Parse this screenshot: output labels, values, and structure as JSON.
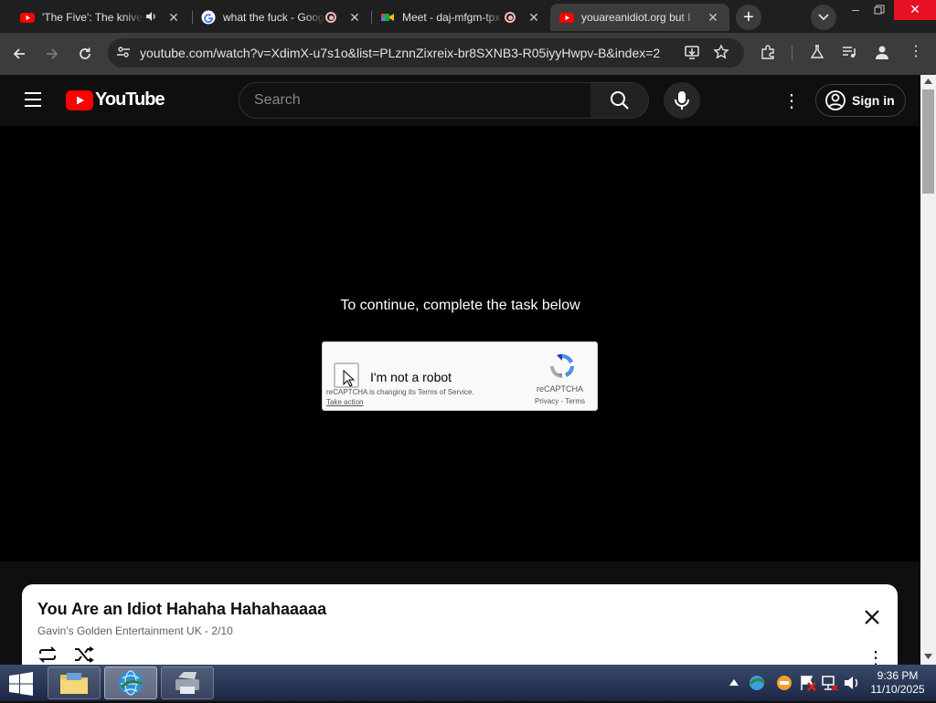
{
  "browser": {
    "tabs": [
      {
        "title": "'The Five': The knives",
        "favicon": "youtube"
      },
      {
        "title": "what the fuck - Google",
        "favicon": "google"
      },
      {
        "title": "Meet - daj-mfgm-tpx",
        "favicon": "meet"
      },
      {
        "title": "youareanidiot.org but I",
        "favicon": "youtube"
      }
    ],
    "url": "youtube.com/watch?v=XdimX-u7s1o&list=PLznnZixreix-br8SXNB3-R05iyyHwpv-B&index=2"
  },
  "yt": {
    "logo_text": "YouTube",
    "search_placeholder": "Search",
    "signin_label": "Sign in"
  },
  "player": {
    "message": "To continue, complete the task below"
  },
  "captcha": {
    "label": "I'm not a robot",
    "notice": "reCAPTCHA is changing its Terms of Service.",
    "take_action": "Take action",
    "brand": "reCAPTCHA",
    "privacy": "Privacy",
    "terms": "Terms",
    "dot": " - "
  },
  "playlist": {
    "title": "You Are an Idiot Hahaha Hahahaaaaa",
    "channel": "Gavin's Golden Entertainment UK",
    "position": "2/10",
    "separator": " - "
  },
  "taskbar": {
    "time": "9:36 PM",
    "date": "11/10/2025"
  },
  "colors": {
    "youtube_red": "#ff0000",
    "browser_bg": "#1f1f1f",
    "toolbar_bg": "#3c3c3c"
  }
}
